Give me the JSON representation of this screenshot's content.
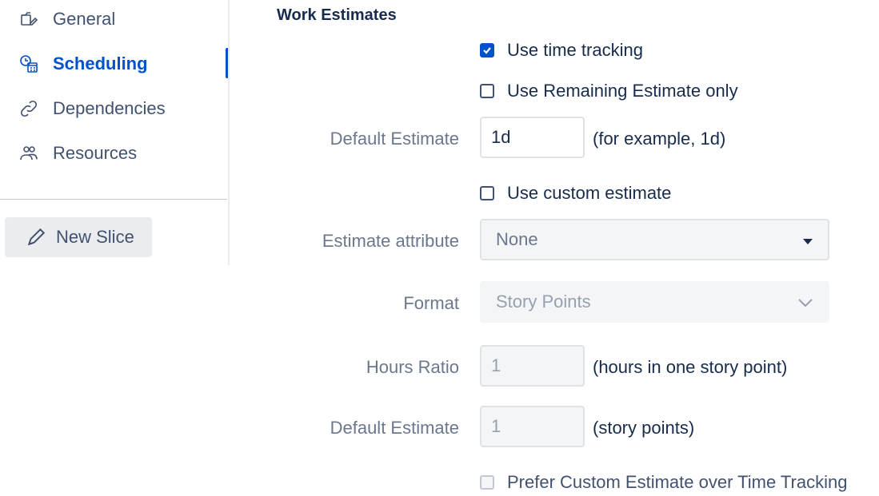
{
  "sidebar": {
    "items": [
      {
        "label": "General",
        "icon": "settings-edit-icon"
      },
      {
        "label": "Scheduling",
        "icon": "calendar-clock-icon",
        "active": true
      },
      {
        "label": "Dependencies",
        "icon": "link-icon"
      },
      {
        "label": "Resources",
        "icon": "people-icon"
      }
    ],
    "new_slice_label": "New Slice"
  },
  "section": {
    "title": "Work Estimates"
  },
  "form": {
    "use_time_tracking": "Use time tracking",
    "use_remaining_only": "Use Remaining Estimate only",
    "default_estimate_label": "Default Estimate",
    "default_estimate_value": "1d",
    "default_estimate_hint": "(for example, 1d)",
    "use_custom_estimate": "Use custom estimate",
    "estimate_attribute_label": "Estimate attribute",
    "estimate_attribute_value": "None",
    "format_label": "Format",
    "format_value": "Story Points",
    "hours_ratio_label": "Hours Ratio",
    "hours_ratio_value": "1",
    "hours_ratio_hint": "(hours in one story point)",
    "custom_default_estimate_label": "Default Estimate",
    "custom_default_estimate_value": "1",
    "custom_default_estimate_hint": "(story points)",
    "prefer_custom": "Prefer Custom Estimate over Time Tracking"
  },
  "colors": {
    "accent": "#0052cc",
    "label": "#6b778c",
    "text": "#172b4d"
  }
}
